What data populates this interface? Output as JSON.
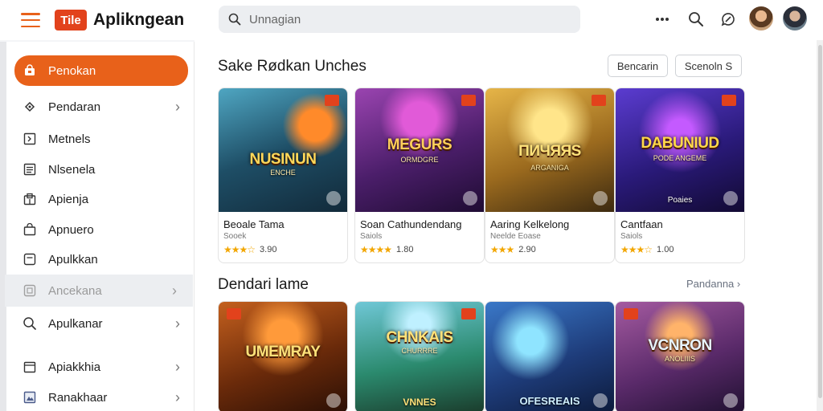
{
  "app": {
    "brand_badge": "Tile",
    "brand_name": "Aplikngean"
  },
  "search": {
    "placeholder": "Unnagian"
  },
  "sidebar": {
    "items": [
      {
        "label": "Penokan",
        "icon": "store-icon",
        "active": true
      },
      {
        "label": "Pendaran",
        "icon": "gamepad-icon",
        "chevron": true
      },
      {
        "label": "Metnels",
        "icon": "panel-icon"
      },
      {
        "label": "Nlsenela",
        "icon": "list-icon"
      },
      {
        "label": "Apienja",
        "icon": "apps-icon"
      },
      {
        "label": "Apnuero",
        "icon": "bag-icon"
      },
      {
        "label": "Apulkkan",
        "icon": "square-icon"
      },
      {
        "label": "Ancekana",
        "icon": "grid-icon",
        "chevron": true,
        "disabled": true
      },
      {
        "label": "Apulkanar",
        "icon": "search-icon",
        "chevron": true
      },
      {
        "label": "Apiakkhia",
        "icon": "folder-icon",
        "chevron": true
      },
      {
        "label": "Ranakhaar",
        "icon": "image-icon",
        "chevron": true
      }
    ]
  },
  "section1": {
    "title": "Sake Rødkan Unches",
    "buttons": [
      "Bencarin",
      "Scenoln S"
    ],
    "cards": [
      {
        "art_title": "NUSINUN",
        "art_sub": "ENCHE",
        "name": "Beoale Tama",
        "dev": "Sooek",
        "rating": "3.90",
        "theme": "#2f6a7f"
      },
      {
        "art_title": "MEGURS",
        "art_sub": "ORMDGRE",
        "name": "Soan Cathundendang",
        "dev": "Saiols",
        "rating": "1.80",
        "theme": "#6b2a7c"
      },
      {
        "art_title": "ПИЧЯЯS",
        "art_sub": "ARGANIGA",
        "name": "Aaring Kelkelong",
        "dev": "Neelde Eoase",
        "rating": "2.90",
        "theme": "#b7862d"
      },
      {
        "art_title": "DABUNIUD",
        "art_sub": "PODE ANGEME",
        "art_caption": "Poaies",
        "name": "Cantfaan",
        "dev": "Saiols",
        "rating": "1.00",
        "theme": "#3a2a8a"
      }
    ]
  },
  "section2": {
    "title": "Dendari lame",
    "see_all": "Pandanna",
    "cards": [
      {
        "art_title": "UMEMRAY",
        "art_sub": "",
        "theme": "#8a3d12"
      },
      {
        "art_title": "CHNKAIS",
        "art_sub": "CHURRRE",
        "art_caption": "VNNES",
        "theme": "#2c8a93"
      },
      {
        "art_title": "",
        "art_sub": "",
        "art_caption": "OFESREAIS",
        "theme": "#2a5a9a"
      },
      {
        "art_title": "VCNRON",
        "art_sub": "ANOLIIIS",
        "theme": "#8a4a8a"
      }
    ]
  },
  "colors": {
    "accent": "#e8611a",
    "brand_badge": "#e2421c",
    "star": "#f2a600"
  }
}
